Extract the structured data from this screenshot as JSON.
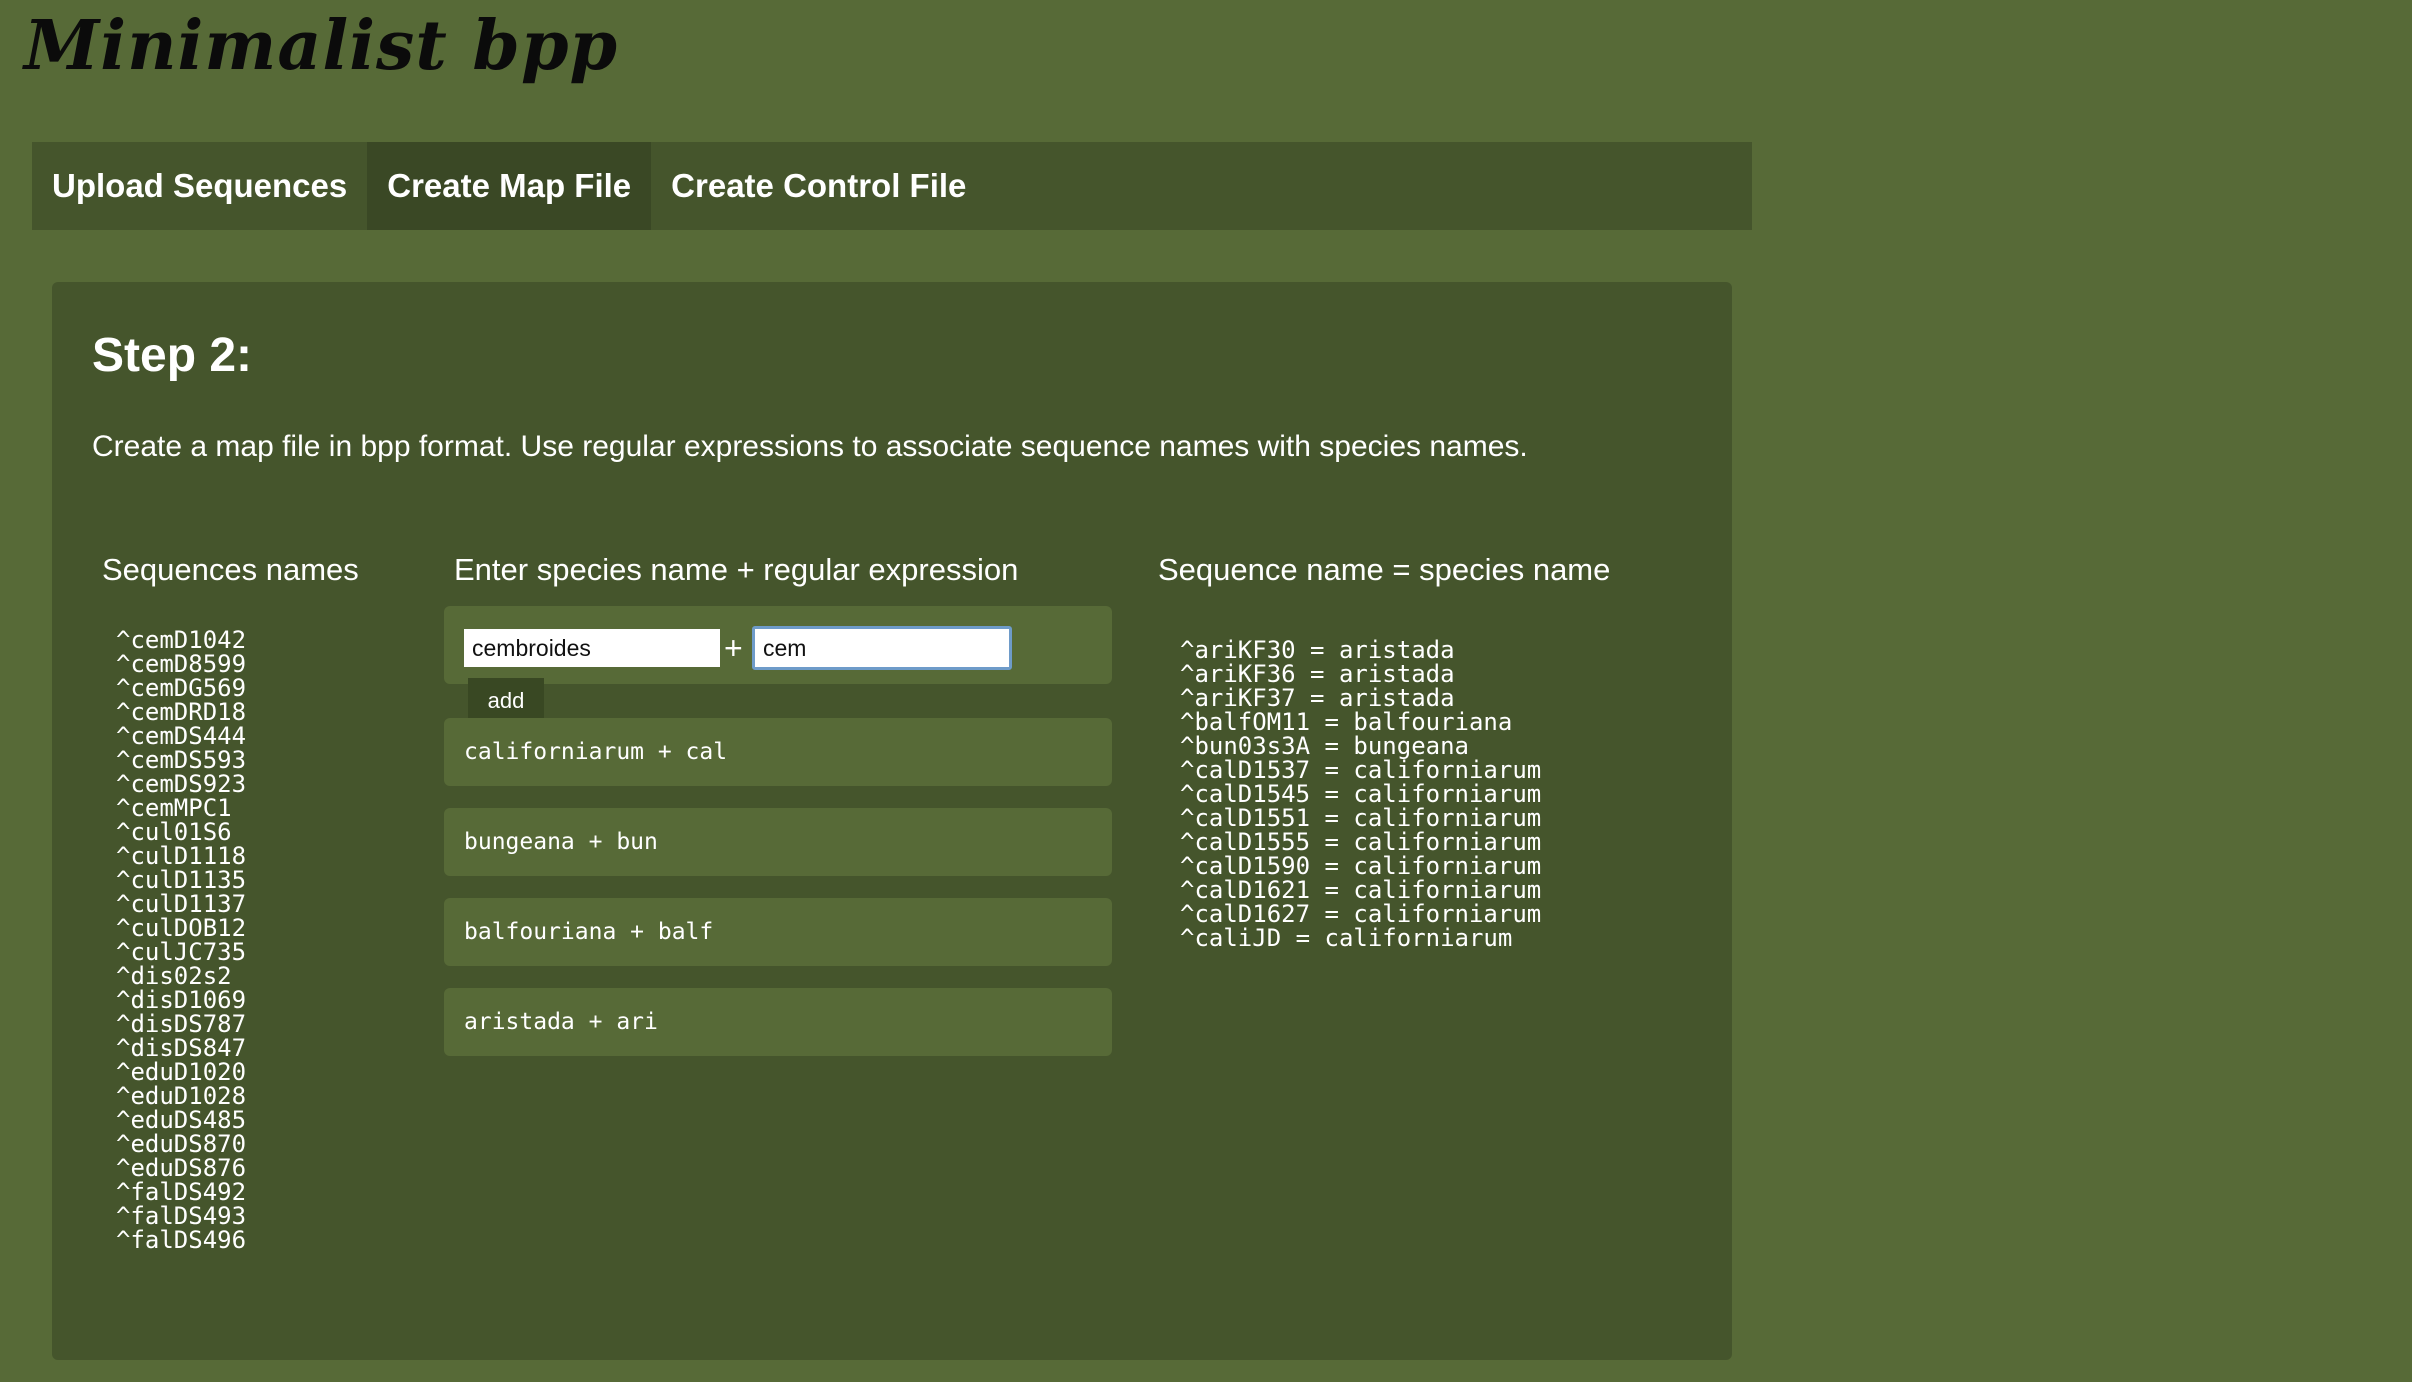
{
  "app": {
    "title": "Minimalist bpp"
  },
  "nav": {
    "tabs": [
      {
        "label": "Upload Sequences",
        "active": false
      },
      {
        "label": "Create Map File",
        "active": true
      },
      {
        "label": "Create Control File",
        "active": false
      }
    ]
  },
  "step": {
    "title": "Step 2:",
    "description": "Create a map file in bpp format. Use regular expressions to associate sequence names with species names."
  },
  "columns": {
    "sequences_heading": "Sequences names",
    "entry_heading": "Enter species name + regular expression",
    "results_heading": "Sequence name = species name"
  },
  "sequences": [
    "^cemD1042",
    "^cemD8599",
    "^cemDG569",
    "^cemDRD18",
    "^cemDS444",
    "^cemDS593",
    "^cemDS923",
    "^cemMPC1",
    "^cul01S6",
    "^culD1118",
    "^culD1135",
    "^culD1137",
    "^culDOB12",
    "^culJC735",
    "^dis02s2",
    "^disD1069",
    "^disDS787",
    "^disDS847",
    "^eduD1020",
    "^eduD1028",
    "^eduDS485",
    "^eduDS870",
    "^eduDS876",
    "^falDS492",
    "^falDS493",
    "^falDS496"
  ],
  "form": {
    "species_value": "cembroides",
    "plus": "+",
    "regex_value": "cem",
    "add_label": "add"
  },
  "mappings": [
    "californiarum + cal",
    "bungeana + bun",
    "balfouriana + balf",
    "aristada + ari"
  ],
  "results": [
    "^ariKF30 = aristada",
    "^ariKF36 = aristada",
    "^ariKF37 = aristada",
    "^balfOM11 = balfouriana",
    "^bun03s3A = bungeana",
    "^calD1537 = californiarum",
    "^calD1545 = californiarum",
    "^calD1551 = californiarum",
    "^calD1555 = californiarum",
    "^calD1590 = californiarum",
    "^calD1621 = californiarum",
    "^calD1627 = californiarum",
    "^caliJD = californiarum"
  ],
  "colors": {
    "page_background": "#576a37",
    "panel_background": "#45552c",
    "active_tab": "#3a4825",
    "input_focus_border": "#6e9bc9"
  }
}
